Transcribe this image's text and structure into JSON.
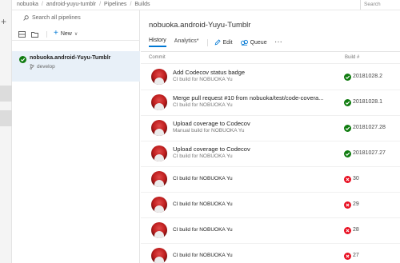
{
  "breadcrumb": [
    "nobuoka",
    "android-yuyu-tumblr",
    "Pipelines",
    "Builds"
  ],
  "search": {
    "label": "Search"
  },
  "left_panel": {
    "search_placeholder": "Search all pipelines",
    "new_label": "New",
    "pipelines": [
      {
        "name": "nobuoka.android-Yuyu-Tumblr",
        "branch": "develop",
        "status": "succeeded"
      }
    ]
  },
  "main": {
    "title": "nobuoka.android-Yuyu-Tumblr",
    "tabs": [
      {
        "label": "History",
        "active": true
      },
      {
        "label": "Analytics*",
        "active": false
      }
    ],
    "actions": {
      "edit": "Edit",
      "queue": "Queue",
      "more": "···"
    },
    "columns": {
      "commit": "Commit",
      "build": "Build #"
    }
  },
  "builds": [
    {
      "message": "Add Codecov status badge",
      "sub": "CI build for NOBUOKA Yu",
      "number": "20181028.2",
      "status": "succeeded"
    },
    {
      "message": "Merge pull request #10 from nobuoka/test/code-covera...",
      "sub": "CI build for NOBUOKA Yu",
      "number": "20181028.1",
      "status": "succeeded"
    },
    {
      "message": "Upload coverage to Codecov",
      "sub": "Manual build for NOBUOKA Yu",
      "number": "20181027.28",
      "status": "succeeded"
    },
    {
      "message": "Upload coverage to Codecov",
      "sub": "CI build for NOBUOKA Yu",
      "number": "20181027.27",
      "status": "succeeded"
    },
    {
      "message": "CI build for NOBUOKA Yu",
      "sub": "",
      "number": "30",
      "status": "failed"
    },
    {
      "message": "CI build for NOBUOKA Yu",
      "sub": "",
      "number": "29",
      "status": "failed"
    },
    {
      "message": "CI build for NOBUOKA Yu",
      "sub": "",
      "number": "28",
      "status": "failed"
    },
    {
      "message": "CI build for NOBUOKA Yu",
      "sub": "",
      "number": "27",
      "status": "failed"
    }
  ],
  "colors": {
    "success": "#107c10",
    "failure": "#e81123",
    "accent": "#0078d4"
  }
}
